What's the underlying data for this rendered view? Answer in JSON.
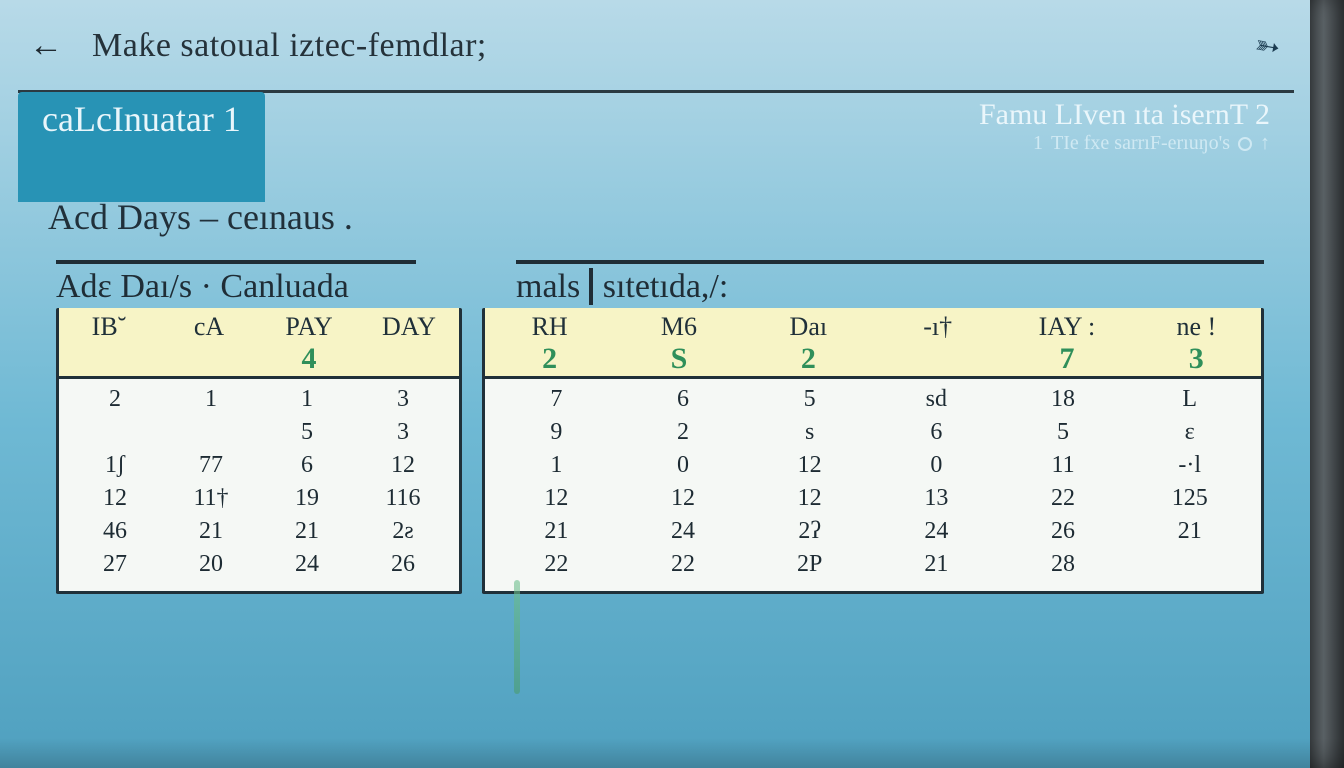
{
  "toolbar": {
    "back_glyph": "←",
    "title": "Maƙe satoual iztec-femdlar;",
    "share_glyph": "➳"
  },
  "tabs": {
    "active_label": "caLcInuatar 1",
    "secondary_title": "Famu LIven ıta isernT  2",
    "secondary_sub_prefix": "1",
    "secondary_sub": "TIe fxe sarrıF-erıuŋo's",
    "secondary_arrow": "↑"
  },
  "subhead": "Acd Days – ceınaus .",
  "panel": {
    "left_title": "Adɛ Daı/s · Canluada",
    "right_title_a": "mals",
    "right_title_b": "sıtetıda,/:"
  },
  "left": {
    "headers": [
      {
        "label": "IB˘",
        "val": ""
      },
      {
        "label": "cA",
        "val": ""
      },
      {
        "label": "PAY",
        "val": "4"
      },
      {
        "label": "DAY",
        "val": ""
      }
    ],
    "rows": [
      [
        "2",
        "1",
        "1",
        "3"
      ],
      [
        "",
        "",
        "5",
        "3"
      ],
      [
        "1ʃ",
        "77",
        "6",
        "12"
      ],
      [
        "12",
        "11†",
        "19",
        "116"
      ],
      [
        "46",
        "21",
        "21",
        "2ƨ"
      ],
      [
        "27",
        "20",
        "24",
        "26"
      ]
    ]
  },
  "right": {
    "headers": [
      {
        "label": "RH",
        "val": "2"
      },
      {
        "label": "M6",
        "val": "S"
      },
      {
        "label": "Daı",
        "val": "2"
      },
      {
        "label": "-ı†",
        "val": ""
      },
      {
        "label": "IAY :",
        "val": "7"
      },
      {
        "label": "ne !",
        "val": "3"
      }
    ],
    "rows": [
      [
        "7",
        "6",
        "5",
        "sd",
        "18",
        "L"
      ],
      [
        "9",
        "2",
        "s",
        "6",
        "5",
        "ɛ"
      ],
      [
        "1",
        "0",
        "12",
        "0",
        "11",
        "-·l"
      ],
      [
        "12",
        "12",
        "12",
        "13",
        "22",
        "125"
      ],
      [
        "21",
        "24",
        "2ʔ",
        "24",
        "26",
        "21"
      ],
      [
        "22",
        "22",
        "2P",
        "21",
        "28",
        ""
      ]
    ]
  }
}
